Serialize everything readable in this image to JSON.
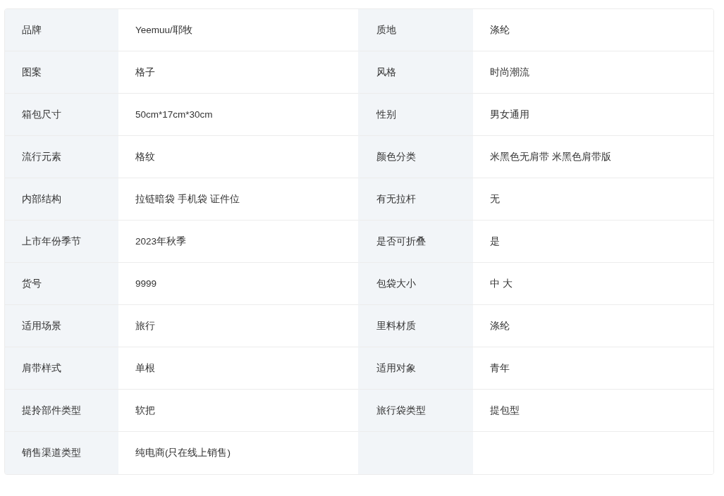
{
  "spec_table": {
    "rows": [
      {
        "pairs": [
          {
            "label": "品牌",
            "value": "Yeemuu/耶牧"
          },
          {
            "label": "质地",
            "value": "涤纶"
          }
        ]
      },
      {
        "pairs": [
          {
            "label": "图案",
            "value": "格子"
          },
          {
            "label": "风格",
            "value": "时尚潮流"
          }
        ]
      },
      {
        "pairs": [
          {
            "label": "箱包尺寸",
            "value": "50cm*17cm*30cm"
          },
          {
            "label": "性别",
            "value": "男女通用"
          }
        ]
      },
      {
        "pairs": [
          {
            "label": "流行元素",
            "value": "格纹"
          },
          {
            "label": "颜色分类",
            "value": "米黑色无肩带 米黑色肩带版"
          }
        ]
      },
      {
        "pairs": [
          {
            "label": "内部结构",
            "value": "拉链暗袋 手机袋 证件位"
          },
          {
            "label": "有无拉杆",
            "value": "无"
          }
        ]
      },
      {
        "pairs": [
          {
            "label": "上市年份季节",
            "value": "2023年秋季"
          },
          {
            "label": "是否可折叠",
            "value": "是"
          }
        ]
      },
      {
        "pairs": [
          {
            "label": "货号",
            "value": "9999"
          },
          {
            "label": "包袋大小",
            "value": "中 大"
          }
        ]
      },
      {
        "pairs": [
          {
            "label": "适用场景",
            "value": "旅行"
          },
          {
            "label": "里料材质",
            "value": "涤纶"
          }
        ]
      },
      {
        "pairs": [
          {
            "label": "肩带样式",
            "value": "单根"
          },
          {
            "label": "适用对象",
            "value": "青年"
          }
        ]
      },
      {
        "pairs": [
          {
            "label": "提拎部件类型",
            "value": "软把"
          },
          {
            "label": "旅行袋类型",
            "value": "提包型"
          }
        ]
      },
      {
        "pairs": [
          {
            "label": "销售渠道类型",
            "value": "纯电商(只在线上销售)"
          }
        ]
      }
    ]
  }
}
